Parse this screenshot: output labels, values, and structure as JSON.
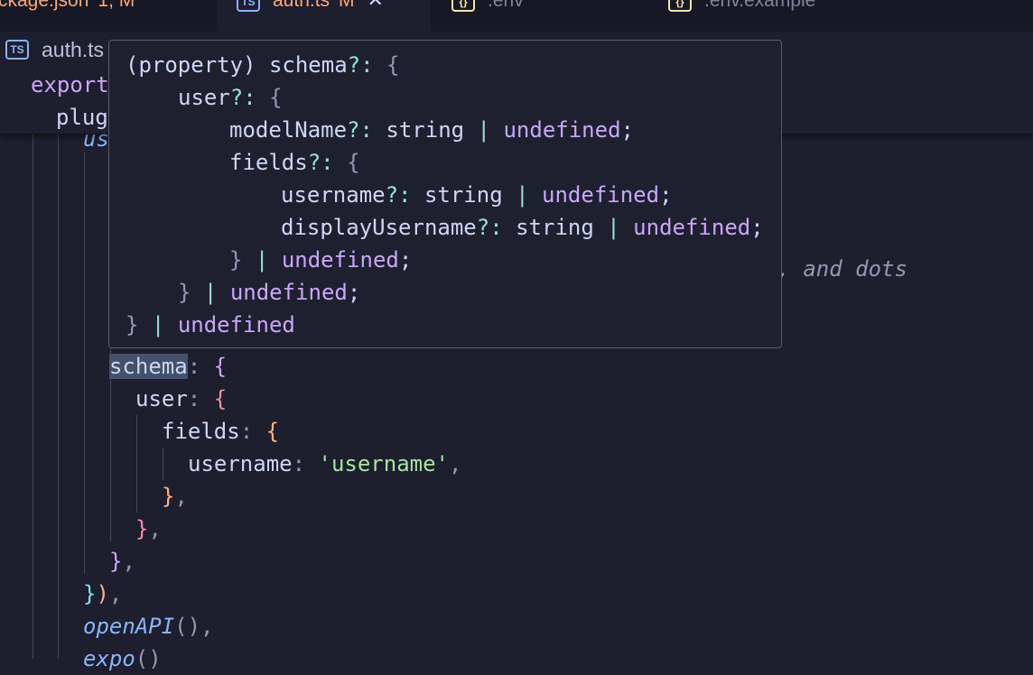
{
  "tabs": [
    {
      "label": "ckage.json",
      "status": "1, M",
      "icon": ""
    },
    {
      "label": "auth.ts",
      "status": "M",
      "icon": "TS",
      "active": true
    },
    {
      "label": ".env",
      "status": "",
      "icon": "{}"
    },
    {
      "label": ".env.example",
      "status": "",
      "icon": "{}"
    }
  ],
  "breadcrumb": {
    "icon": "TS",
    "file": "auth.ts"
  },
  "sticky": {
    "line1": "export",
    "line2": "plug"
  },
  "code": {
    "us": "us",
    "comment_tail": "s, and dots",
    "schema_key": "schema",
    "user_key": "user",
    "fields_key": "fields",
    "username_key": "username",
    "username_value": "'username'",
    "openapi": "openAPI",
    "expo": "expo"
  },
  "hover": {
    "l1_a": "(property) schema",
    "l2_a": "user",
    "l3_a": "modelName",
    "l4_a": "fields",
    "l5_a": "username",
    "l6_a": "displayUsername",
    "type_string": "string",
    "type_undefined": "undefined"
  },
  "colors": {
    "background": "#1e1e2e",
    "accent": "#cba6f7",
    "string": "#a6e3a1",
    "modified": "#f5a97f"
  }
}
